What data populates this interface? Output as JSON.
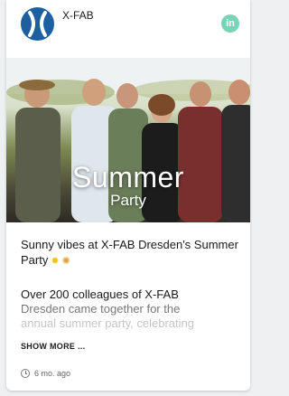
{
  "post": {
    "author": "X-FAB",
    "network_badge": "in",
    "photo_title_line1": "Summer",
    "photo_title_line2": "Party",
    "headline": "Sunny vibes at X-FAB Dresden's Summer Party",
    "headline_emojis": [
      "sun-emoji",
      "party-popper-emoji"
    ],
    "body_line1": "Over 200 colleagues of X-FAB",
    "body_line2": "Dresden came together for the",
    "body_line3": "annual summer party, celebrating",
    "show_more": "SHOW MORE ...",
    "time_ago": "6 mo. ago"
  },
  "colors": {
    "brand_avatar": "#1e5fa0",
    "linkedin_badge": "#7ad3b8",
    "text_primary": "#1a1a1a",
    "text_faded": "#c6c6c6"
  }
}
